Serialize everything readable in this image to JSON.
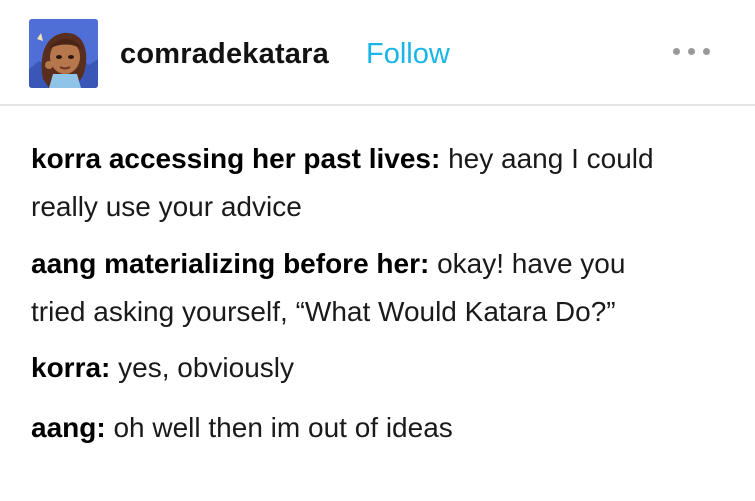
{
  "header": {
    "username": "comradekatara",
    "follow_label": "Follow",
    "avatar_icon": "avatar-illustration",
    "more_icon": "more-options-icon",
    "accent_color": "#19b5e8"
  },
  "post": {
    "paragraphs": [
      {
        "speaker": "korra accessing her past lives:",
        "line1": " hey aang I could",
        "line2": "really use your advice"
      },
      {
        "speaker": "aang materializing before her:",
        "line1": " okay! have you",
        "line2": "tried asking yourself, “What Would Katara Do?”"
      },
      {
        "speaker": "korra:",
        "line1": " yes, obviously"
      },
      {
        "speaker": "aang:",
        "line1": " oh well then im out of ideas"
      }
    ]
  }
}
